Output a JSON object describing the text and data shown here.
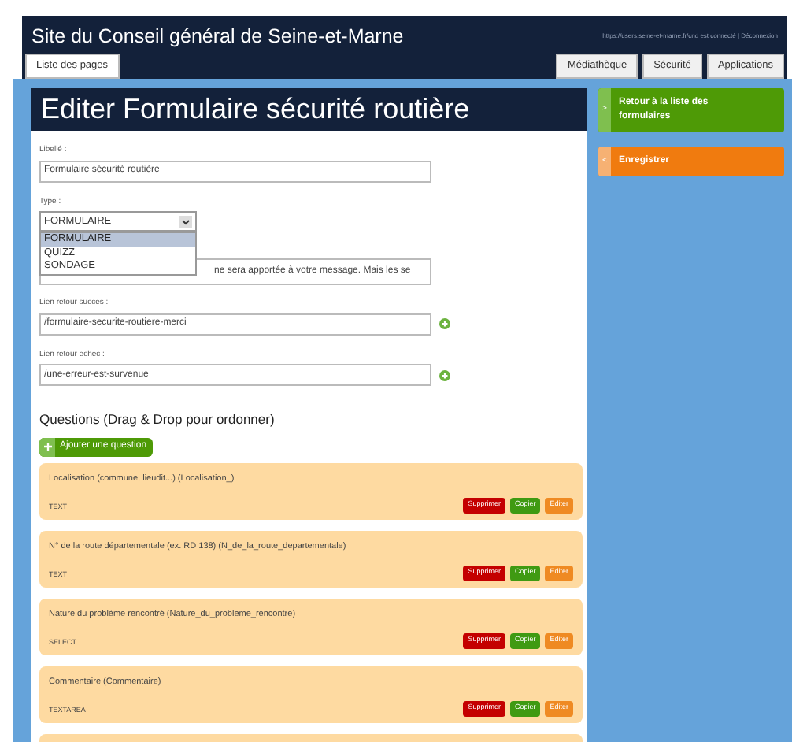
{
  "header": {
    "site_title": "Site du Conseil général de Seine-et-Marne",
    "user_links": "https://users.seine-et-marne.fr/cnd est connecté | Déconnexion"
  },
  "tabs": [
    {
      "label": "Liste des pages",
      "selected": true
    },
    {
      "label": "Médiathèque",
      "selected": false
    },
    {
      "label": "Sécurité",
      "selected": false
    },
    {
      "label": "Applications",
      "selected": false
    }
  ],
  "page_title": "Editer Formulaire sécurité routière",
  "form": {
    "libelle_label": "Libellé :",
    "libelle_value": "Formulaire sécurité routière",
    "type_label": "Type :",
    "type_value": "FORMULAIRE",
    "type_options": [
      {
        "label": "FORMULAIRE",
        "selected": true
      },
      {
        "label": "QUIZZ",
        "selected": false
      },
      {
        "label": "SONDAGE",
        "selected": false
      }
    ],
    "message_value": "ne sera apportée à votre message. Mais les se",
    "success_label": "Lien retour succes :",
    "success_value": "/formulaire-securite-routiere-merci",
    "failure_label": "Lien retour echec :",
    "failure_value": "/une-erreur-est-survenue"
  },
  "questions": {
    "heading": "Questions (Drag & Drop pour ordonner)",
    "add_button": "Ajouter une question",
    "items": [
      {
        "label": "Localisation (commune, lieudit...) (Localisation_)",
        "type": "TEXT",
        "actions": [
          {
            "label": "Supprimer",
            "kind": "delete"
          },
          {
            "label": "Copier",
            "kind": "copy"
          },
          {
            "label": "Editer",
            "kind": "edit"
          }
        ]
      },
      {
        "label": "N° de la route départementale (ex. RD 138) (N_de_la_route_departementale)",
        "type": "TEXT",
        "actions": [
          {
            "label": "Supprimer",
            "kind": "delete"
          },
          {
            "label": "Copier",
            "kind": "copy"
          },
          {
            "label": "Editer",
            "kind": "edit"
          }
        ]
      },
      {
        "label": "Nature du problème rencontré (Nature_du_probleme_rencontre)",
        "type": "SELECT",
        "actions": [
          {
            "label": "Supprimer",
            "kind": "delete"
          },
          {
            "label": "Copier",
            "kind": "copy"
          },
          {
            "label": "Editer",
            "kind": "edit"
          }
        ]
      },
      {
        "label": "Commentaire (Commentaire)",
        "type": "TEXTAREA",
        "actions": [
          {
            "label": "Supprimer",
            "kind": "delete"
          },
          {
            "label": "Copier",
            "kind": "copy"
          },
          {
            "label": "Editer",
            "kind": "edit"
          }
        ]
      }
    ]
  },
  "sidebar": [
    {
      "label": "Retour à la liste des formulaires",
      "kind": "back",
      "arrow": ">"
    },
    {
      "label": "Enregistrer",
      "kind": "save",
      "arrow": "<"
    }
  ]
}
